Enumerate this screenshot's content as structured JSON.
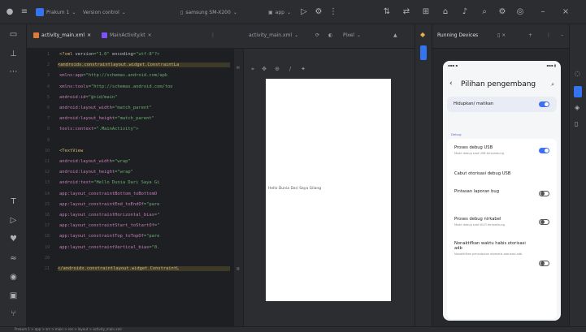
{
  "titlebar": {
    "project": "Prakum 1",
    "vcs": "Version control",
    "device": "samsung SM-X200",
    "run_config": "app"
  },
  "editor_tabs": [
    {
      "label": "activity_main.xml",
      "active": true,
      "type": "xml"
    },
    {
      "label": "MainActivity.kt",
      "active": false,
      "type": "kt"
    }
  ],
  "code": {
    "lines": [
      {
        "n": "1",
        "parts": [
          [
            "t-tag",
            "<?xml "
          ],
          [
            "t-attr",
            "version"
          ],
          [
            "t-val",
            "=\"1.0\" "
          ],
          [
            "t-attr",
            "encoding"
          ],
          [
            "t-val",
            "=\"utf-8\"?>"
          ]
        ]
      },
      {
        "n": "2",
        "parts": [
          [
            "t-tag",
            "<androidx.constraintlayout.widget.ConstraintLa"
          ]
        ],
        "hl": true
      },
      {
        "n": "3",
        "parts": [
          [
            "t-ns",
            "    xmlns:app"
          ],
          [
            "t-val",
            "=\"http://schemas.android.com/apk"
          ]
        ]
      },
      {
        "n": "4",
        "parts": [
          [
            "t-ns",
            "    xmlns:tools"
          ],
          [
            "t-val",
            "=\"http://schemas.android.com/too"
          ]
        ]
      },
      {
        "n": "5",
        "parts": [
          [
            "t-ns",
            "    android:id"
          ],
          [
            "t-val",
            "=\"@+id/main\""
          ]
        ]
      },
      {
        "n": "6",
        "parts": [
          [
            "t-ns",
            "    android:layout_width"
          ],
          [
            "t-val",
            "=\"match_parent\""
          ]
        ]
      },
      {
        "n": "7",
        "parts": [
          [
            "t-ns",
            "    android:layout_height"
          ],
          [
            "t-val",
            "=\"match_parent\""
          ]
        ]
      },
      {
        "n": "8",
        "parts": [
          [
            "t-ns",
            "    tools:context"
          ],
          [
            "t-val",
            "=\".MainActivity\">"
          ]
        ]
      },
      {
        "n": "9",
        "parts": [
          [
            "t-attr",
            ""
          ]
        ]
      },
      {
        "n": "10",
        "parts": [
          [
            "t-tag",
            "    <TextView"
          ]
        ]
      },
      {
        "n": "11",
        "parts": [
          [
            "t-ns",
            "        android:layout_width"
          ],
          [
            "t-val",
            "=\"wrap\""
          ]
        ]
      },
      {
        "n": "12",
        "parts": [
          [
            "t-ns",
            "        android:layout_height"
          ],
          [
            "t-val",
            "=\"wrap\""
          ]
        ]
      },
      {
        "n": "13",
        "parts": [
          [
            "t-ns",
            "        android:text"
          ],
          [
            "t-val",
            "=\"Hello Dunia Dari Saya Gi"
          ]
        ]
      },
      {
        "n": "14",
        "parts": [
          [
            "t-ns",
            "        app:layout_constraintBottom_toBottomO"
          ]
        ]
      },
      {
        "n": "15",
        "parts": [
          [
            "t-ns",
            "        app:layout_constraintEnd_toEndOf"
          ],
          [
            "t-val",
            "=\"pare"
          ]
        ]
      },
      {
        "n": "16",
        "parts": [
          [
            "t-ns",
            "        app:layout_constraintHorizontal_bias"
          ],
          [
            "t-val",
            "=\""
          ]
        ]
      },
      {
        "n": "17",
        "parts": [
          [
            "t-ns",
            "        app:layout_constraintStart_toStartOf"
          ],
          [
            "t-val",
            "=\""
          ]
        ]
      },
      {
        "n": "18",
        "parts": [
          [
            "t-ns",
            "        app:layout_constraintTop_toTopOf"
          ],
          [
            "t-val",
            "=\"pare"
          ]
        ]
      },
      {
        "n": "19",
        "parts": [
          [
            "t-ns",
            "        app:layout_constraintVertical_bias"
          ],
          [
            "t-val",
            "=\"0."
          ]
        ]
      },
      {
        "n": "20",
        "parts": [
          [
            "t-attr",
            ""
          ]
        ]
      },
      {
        "n": "21",
        "parts": [
          [
            "t-tag",
            "</androidx.constraintlayout.widget.ConstraintL"
          ]
        ],
        "hl": true
      }
    ]
  },
  "design": {
    "file_tab": "activity_main.xml",
    "zoom_label": "Pixel",
    "canvas_text": "Hello Dunia Dari Saya Gilang"
  },
  "device_panel": {
    "title": "Running Devices",
    "phone": {
      "title": "Pilihan pengembang",
      "master_toggle": "Hidupkan/ matikan",
      "section": "Debug",
      "items": [
        {
          "label": "Proses debug USB",
          "sub": "Mode debug saat USB tersambung",
          "toggle": "on"
        },
        {
          "label": "Cabut otorisasi debug USB",
          "sub": "",
          "toggle": "none"
        },
        {
          "label": "Pintasan laporan bug",
          "sub": "",
          "toggle": "off"
        },
        {
          "label": "Proses debug nirkabel",
          "sub": "Mode debug saat Wi-Fi tersambung",
          "toggle": "off"
        },
        {
          "label": "Nonaktifkan waktu habis otorisasi adb",
          "sub": "Nonaktifkan pencabutan otomatis otorisasi adb",
          "toggle": "off"
        }
      ]
    }
  },
  "statusbar": {
    "text": "Prakum 1 > app > src > main > res > layout > activity_main.xml"
  }
}
